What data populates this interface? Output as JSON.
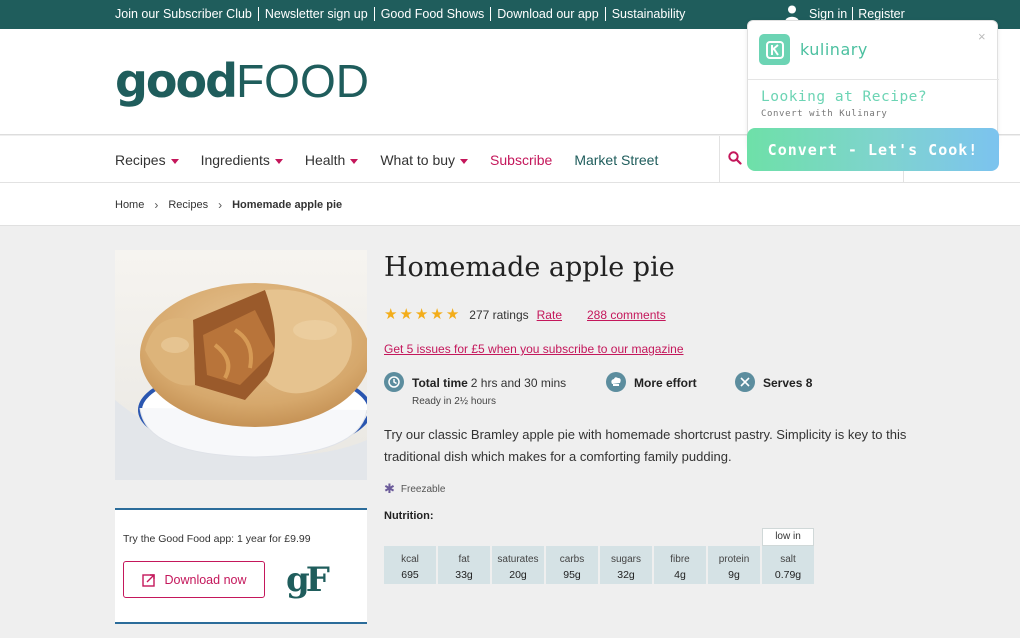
{
  "topbar": {
    "links": [
      "Join our Subscriber Club",
      "Newsletter sign up",
      "Good Food Shows",
      "Download our app",
      "Sustainability"
    ],
    "sign_in": "Sign in",
    "register": "Register"
  },
  "brand": {
    "logo_part1": "good",
    "logo_part2": "FOOD",
    "color": "#1f5d5c",
    "accent": "#c4175b"
  },
  "nav": {
    "items": [
      {
        "label": "Recipes",
        "has_dropdown": true
      },
      {
        "label": "Ingredients",
        "has_dropdown": true
      },
      {
        "label": "Health",
        "has_dropdown": true
      },
      {
        "label": "What to buy",
        "has_dropdown": true
      },
      {
        "label": "Subscribe",
        "has_dropdown": false
      },
      {
        "label": "Market Street",
        "has_dropdown": false
      }
    ],
    "search_icon": "search-icon"
  },
  "breadcrumb": {
    "items": [
      "Home",
      "Recipes",
      "Homemade apple pie"
    ]
  },
  "recipe": {
    "title": "Homemade apple pie",
    "rating": 5,
    "ratings_count": "277 ratings",
    "rate_label": "Rate",
    "comments_label": "288 comments",
    "promo": "Get 5 issues for £5 when you subscribe to our magazine",
    "total_time_label": "Total time",
    "total_time_value": "2 hrs and 30 mins",
    "ready_in": "Ready in 2½ hours",
    "effort": "More effort",
    "serves": "Serves 8",
    "description": "Try our classic Bramley apple pie with homemade shortcrust pastry. Simplicity is key to this traditional dish which makes for a comforting family pudding.",
    "freezable": "Freezable"
  },
  "nutrition": {
    "title": "Nutrition:",
    "low_in": "low in",
    "items": [
      {
        "label": "kcal",
        "value": "695"
      },
      {
        "label": "fat",
        "value": "33g"
      },
      {
        "label": "saturates",
        "value": "20g"
      },
      {
        "label": "carbs",
        "value": "95g"
      },
      {
        "label": "sugars",
        "value": "32g"
      },
      {
        "label": "fibre",
        "value": "4g"
      },
      {
        "label": "protein",
        "value": "9g"
      },
      {
        "label": "salt",
        "value": "0.79g"
      }
    ]
  },
  "app_promo": {
    "text": "Try the Good Food app: 1 year for £9.99",
    "button": "Download now",
    "logo": "gF"
  },
  "kulinary": {
    "name": "kulinary",
    "close": "×",
    "heading": "Looking at Recipe?",
    "subheading": "Convert with Kulinary",
    "button": "Convert - Let's Cook!"
  }
}
